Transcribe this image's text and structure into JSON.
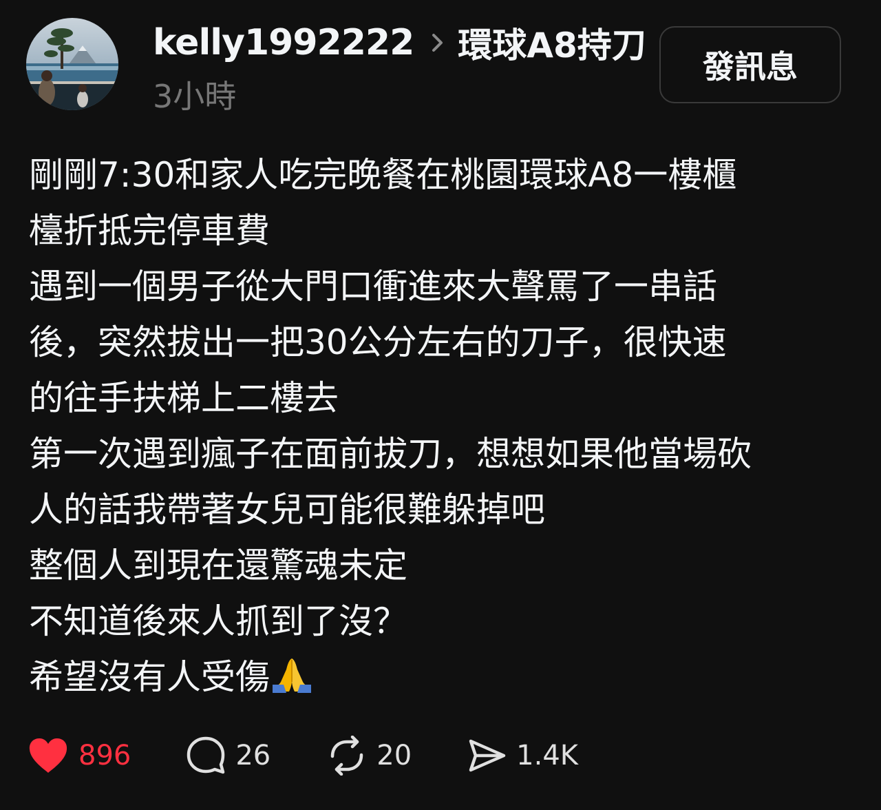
{
  "post": {
    "author": {
      "username": "kelly1992222",
      "avatar_icon": "profile-photo-avatar"
    },
    "topic": "環球A8持刀",
    "separator_icon": "chevron-right-icon",
    "timestamp": "3小時",
    "message_button_label": "發訊息",
    "lines": [
      "剛剛7:30和家人吃完晚餐在桃園環球A8一樓櫃",
      "檯折抵完停車費",
      "遇到一個男子從大門口衝進來大聲罵了一串話",
      "後，突然拔出一把30公分左右的刀子，很快速",
      "的往手扶梯上二樓去",
      "第一次遇到瘋子在面前拔刀，想想如果他當場砍",
      "人的話我帶著女兒可能很難躲掉吧",
      "整個人到現在還驚魂未定",
      "不知道後來人抓到了沒？",
      "希望沒有人受傷"
    ],
    "closing_emoji": "folded-hands-emoji"
  },
  "actions": {
    "like": {
      "icon": "heart-icon",
      "count": "896",
      "liked": true,
      "color": "#ff3040"
    },
    "comment": {
      "icon": "comment-icon",
      "count": "26"
    },
    "repost": {
      "icon": "repost-icon",
      "count": "20"
    },
    "share": {
      "icon": "share-icon",
      "count": "1.4K"
    }
  },
  "theme": {
    "background": "#101010",
    "text": "#f3f5f7",
    "muted": "#777777",
    "border": "#3a3a3a"
  }
}
